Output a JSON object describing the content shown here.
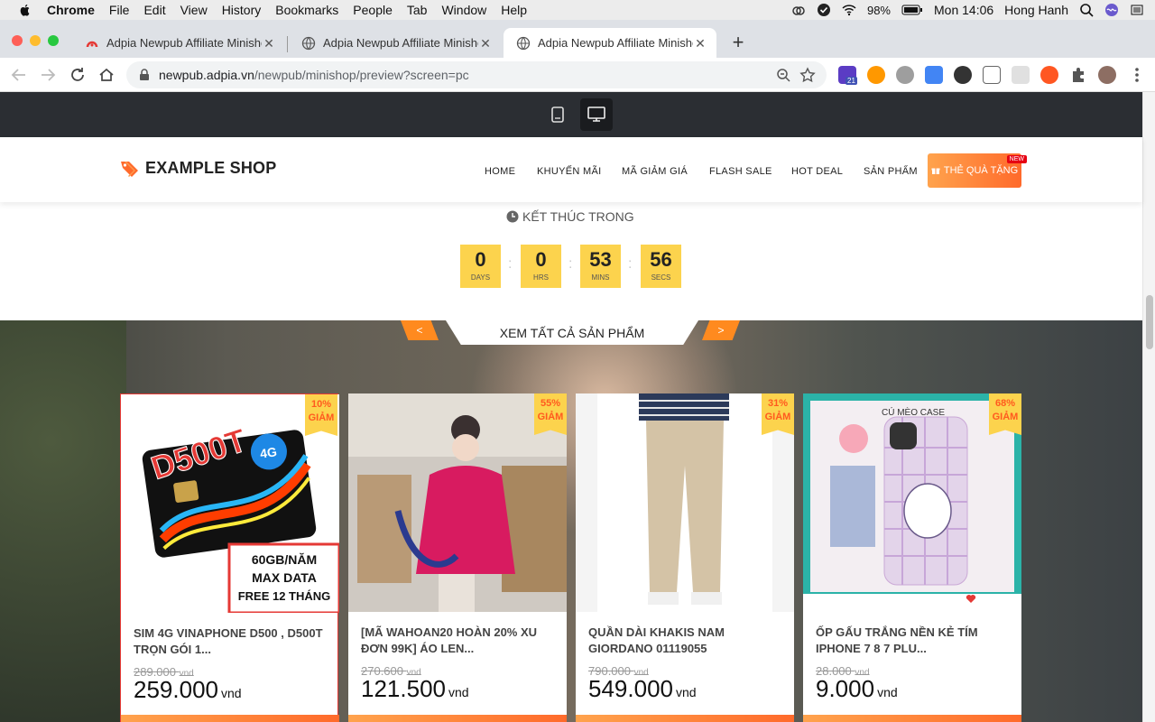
{
  "menubar": {
    "app": "Chrome",
    "items": [
      "File",
      "Edit",
      "View",
      "History",
      "Bookmarks",
      "People",
      "Tab",
      "Window",
      "Help"
    ],
    "battery": "98%",
    "clock": "Mon 14:06",
    "user": "Hong Hanh"
  },
  "tabs": [
    {
      "title": "Adpia Newpub Affiliate Minishop"
    },
    {
      "title": "Adpia Newpub Affiliate Minishop"
    },
    {
      "title": "Adpia Newpub Affiliate Minishop"
    }
  ],
  "omnibox": {
    "host": "newpub.adpia.vn",
    "path": "/newpub/minishop/preview?screen=pc"
  },
  "extensions": {
    "badge": "21"
  },
  "shop": {
    "logo": "EXAMPLE SHOP",
    "nav": [
      "HOME",
      "KHUYẾN MÃI",
      "MÃ GIẢM GIÁ",
      "FLASH SALE",
      "HOT DEAL",
      "SẢN PHẨM"
    ],
    "gift_label": "THẺ QUÀ TẶNG",
    "new_badge": "NEW",
    "ends_label": "KẾT THÚC TRONG",
    "countdown": [
      {
        "value": "0",
        "unit": "DAYS"
      },
      {
        "value": "0",
        "unit": "HRS"
      },
      {
        "value": "53",
        "unit": "MINS"
      },
      {
        "value": "56",
        "unit": "SECS"
      }
    ],
    "view_all": "XEM TẤT CẢ SẢN PHẨM",
    "prev": "<",
    "next": ">"
  },
  "products": [
    {
      "name": "SIM 4G VINAPHONE D500 , D500T TRỌN GÓI 1...",
      "discount": "10%",
      "discount_word": "GIẢM",
      "old_price": "289.000",
      "price": "259.000",
      "unit": "vnd",
      "img_text": [
        "D500T",
        "60GB/NĂM",
        "MAX DATA",
        "FREE 12 THÁNG"
      ]
    },
    {
      "name": "[MÃ WAHOAN20 HOÀN 20% XU ĐƠN 99K] ÁO LEN...",
      "discount": "55%",
      "discount_word": "GIẢM",
      "old_price": "270.600",
      "price": "121.500",
      "unit": "vnd"
    },
    {
      "name": "QUẦN DÀI KHAKIS NAM GIORDANO 01119055",
      "discount": "31%",
      "discount_word": "GIẢM",
      "old_price": "790.000",
      "price": "549.000",
      "unit": "vnd"
    },
    {
      "name": "ỐP GẤU TRẮNG NỀN KẺ TÍM IPHONE 7 8 7 PLU...",
      "discount": "68%",
      "discount_word": "GIẢM",
      "old_price": "28.000",
      "price": "9.000",
      "unit": "vnd",
      "img_text": [
        "CÚ MÈO CASE"
      ]
    }
  ],
  "colors": {
    "accent": "#ff8a1f",
    "countdown_bg": "#fcd34d",
    "dark_bar": "#2b2e33"
  }
}
